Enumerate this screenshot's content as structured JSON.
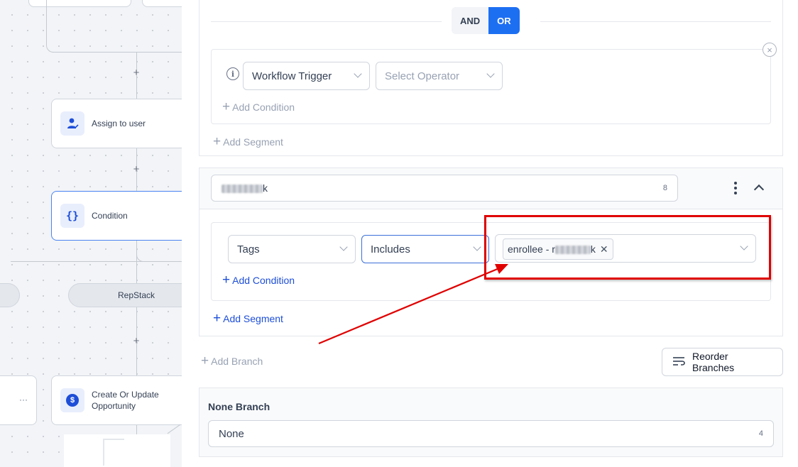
{
  "canvas": {
    "nodes": {
      "assign_user": "Assign to user",
      "condition": "Condition",
      "create_opportunity_line1": "Create Or Update",
      "create_opportunity_line2": "Opportunity"
    },
    "branch_pills": {
      "repstack": "RepStack"
    },
    "icons": {
      "plus": "+",
      "ellipsis": "···",
      "braces": "{}",
      "dollar": "$"
    }
  },
  "segment1": {
    "toggle": {
      "and": "AND",
      "or": "OR"
    },
    "condition": {
      "field": "Workflow Trigger",
      "operator_placeholder": "Select Operator"
    },
    "add_condition": "Add Condition",
    "add_segment": "Add Segment"
  },
  "branch2": {
    "name_suffix": "k",
    "name_count": "8",
    "condition": {
      "field": "Tags",
      "operator": "Includes",
      "tag_prefix": "enrollee - r",
      "tag_suffix": "k"
    },
    "add_condition": "Add Condition",
    "add_segment": "Add Segment"
  },
  "actions": {
    "add_branch": "Add Branch",
    "reorder_branches": "Reorder Branches"
  },
  "none_branch": {
    "title": "None Branch",
    "name": "None",
    "count": "4"
  },
  "colors": {
    "primary": "#1d6ff2",
    "annotation_red": "#e00000"
  }
}
